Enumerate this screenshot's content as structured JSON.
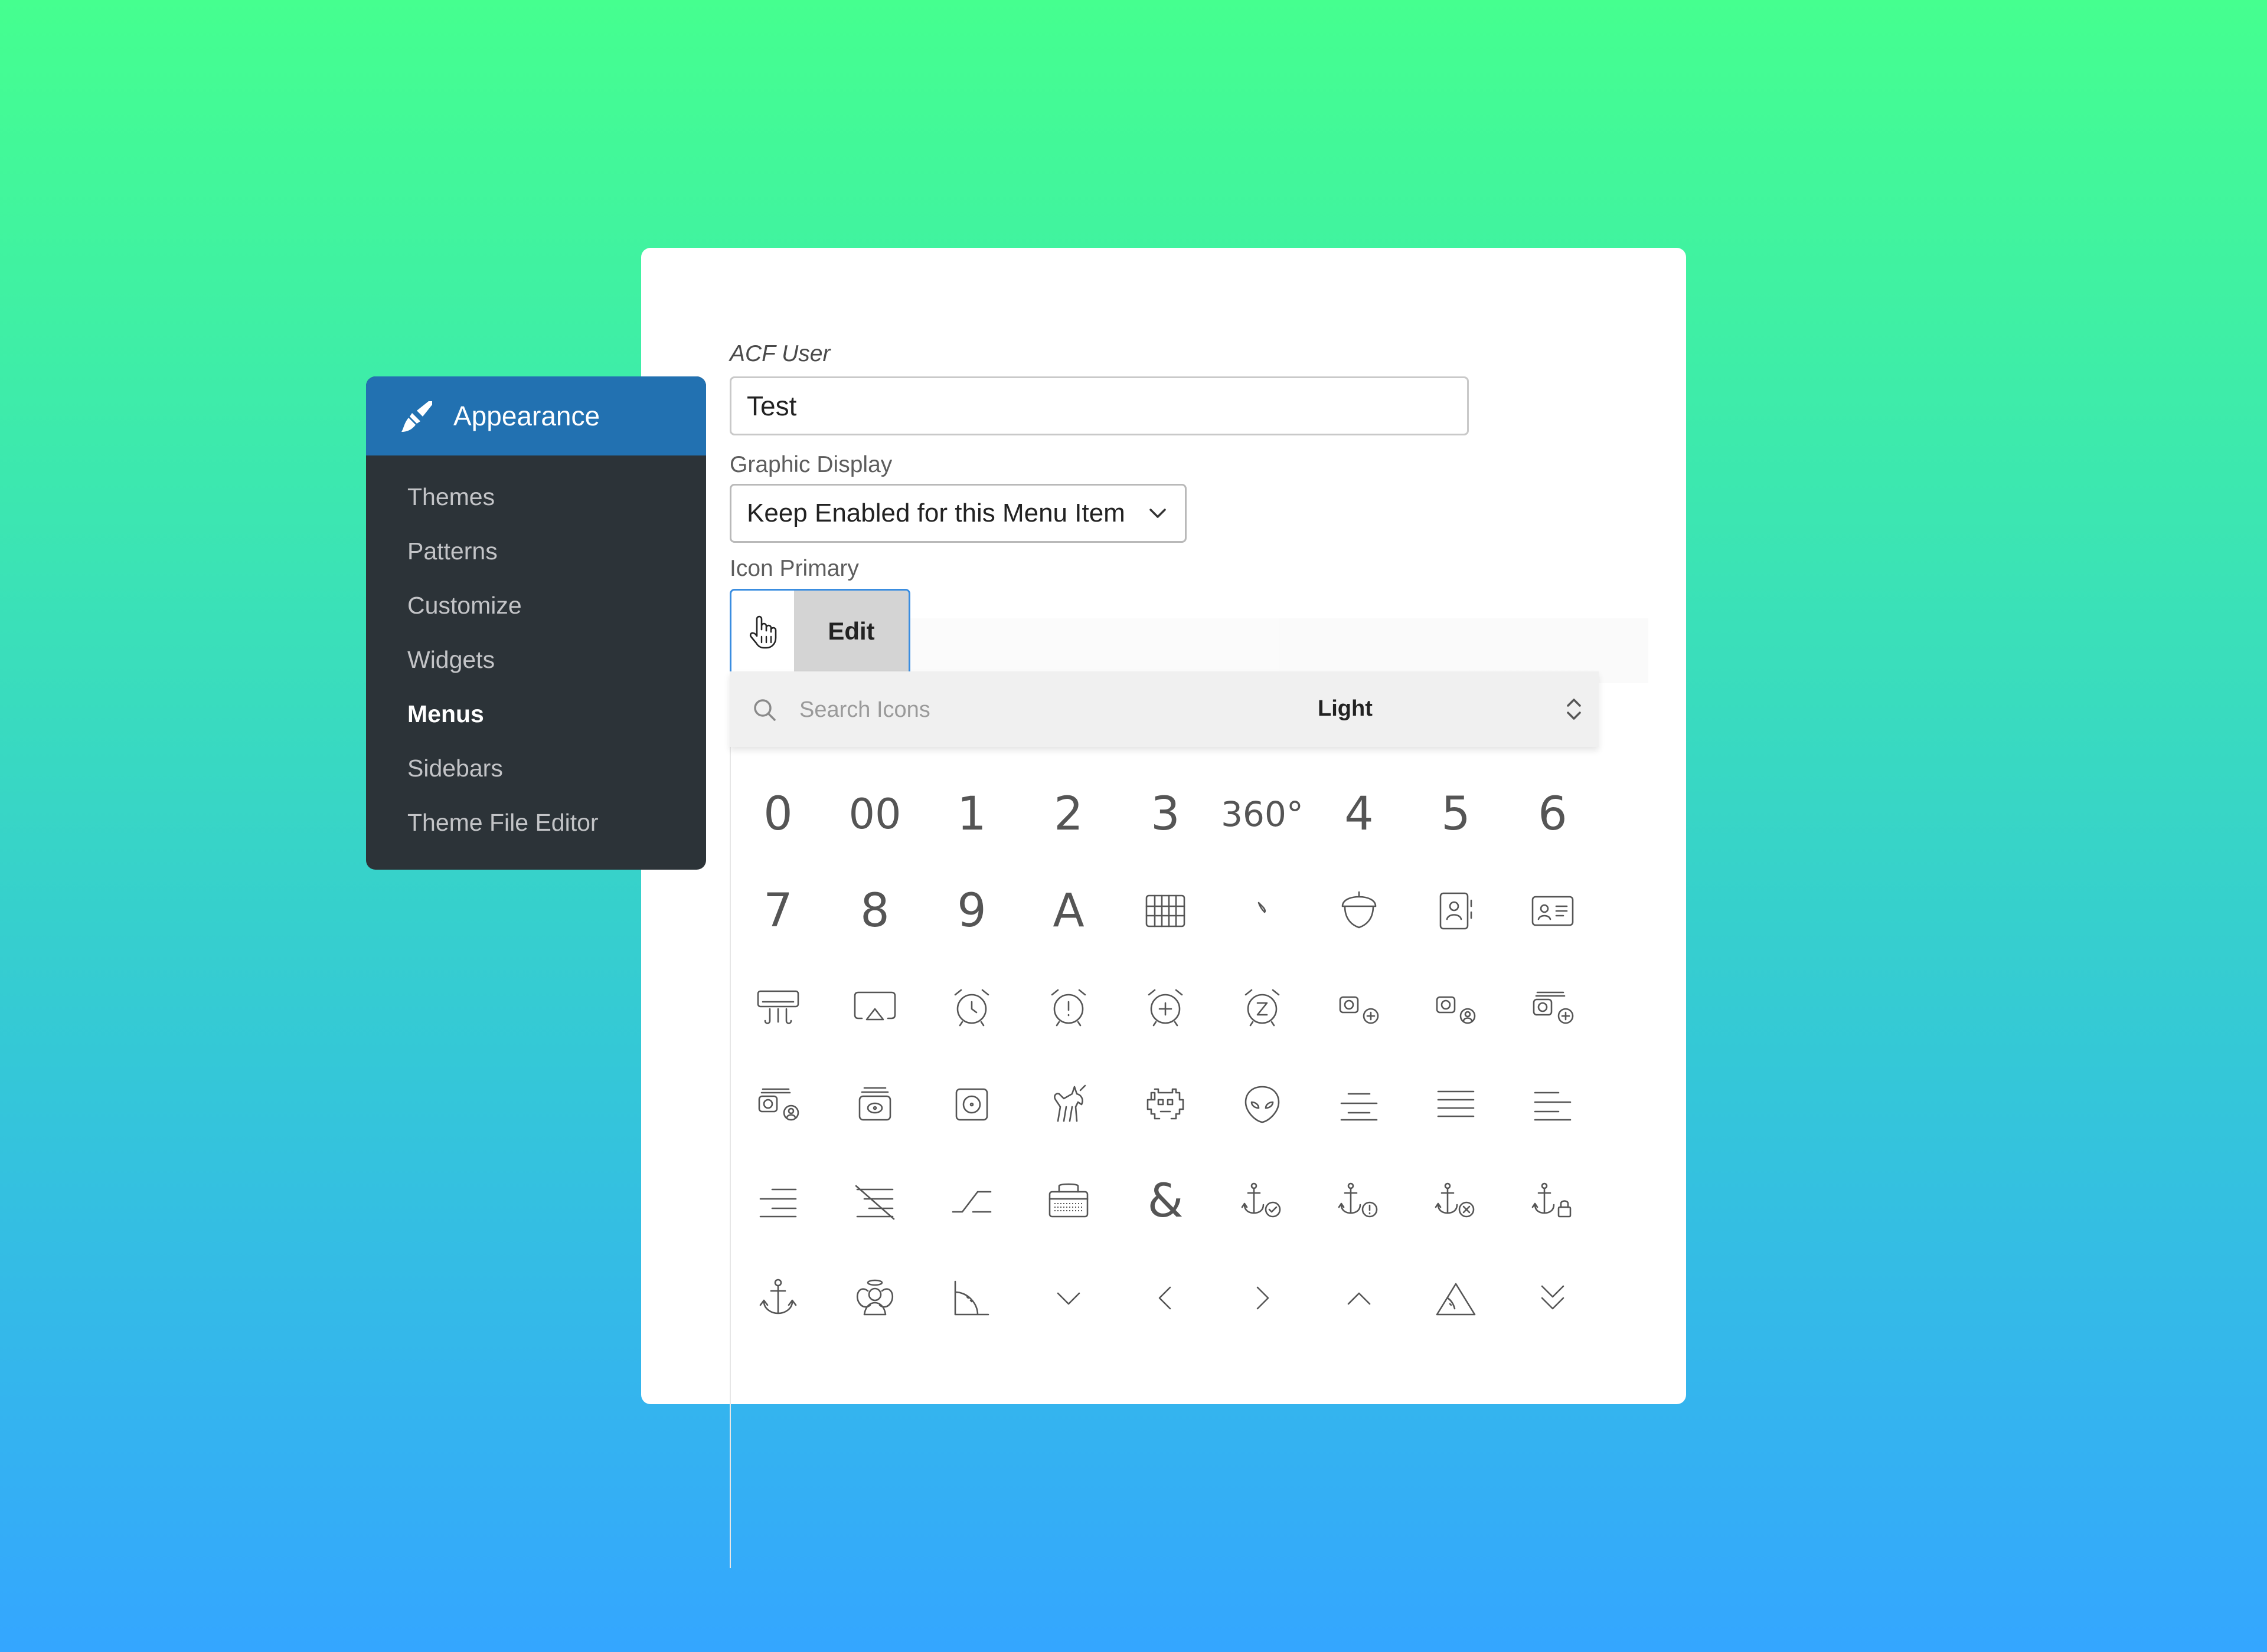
{
  "sidebar": {
    "title": "Appearance",
    "items": [
      {
        "label": "Themes"
      },
      {
        "label": "Patterns"
      },
      {
        "label": "Customize"
      },
      {
        "label": "Widgets"
      },
      {
        "label": "Menus",
        "active": true
      },
      {
        "label": "Sidebars"
      },
      {
        "label": "Theme File Editor"
      }
    ],
    "header_color": "#2271b1",
    "bg_color": "#2c3338"
  },
  "form": {
    "acf_user_label": "ACF User",
    "acf_user_value": "Test",
    "graphic_display_label": "Graphic Display",
    "graphic_display_value": "Keep Enabled for this Menu Item",
    "icon_primary_label": "Icon Primary",
    "edit_label": "Edit"
  },
  "icon_panel": {
    "search_placeholder": "Search Icons",
    "style_value": "Light",
    "icons": [
      {
        "name": "0",
        "glyph": "0"
      },
      {
        "name": "00",
        "glyph": "00"
      },
      {
        "name": "1",
        "glyph": "1"
      },
      {
        "name": "2",
        "glyph": "2"
      },
      {
        "name": "3",
        "glyph": "3"
      },
      {
        "name": "360-degrees",
        "glyph": "360°"
      },
      {
        "name": "4",
        "glyph": "4"
      },
      {
        "name": "5",
        "glyph": "5"
      },
      {
        "name": "6",
        "glyph": "6"
      },
      {
        "name": "7",
        "glyph": "7"
      },
      {
        "name": "8",
        "glyph": "8"
      },
      {
        "name": "9",
        "glyph": "9"
      },
      {
        "name": "a",
        "glyph": "A"
      },
      {
        "name": "abacus"
      },
      {
        "name": "accent-grave"
      },
      {
        "name": "acorn"
      },
      {
        "name": "address-book"
      },
      {
        "name": "address-card"
      },
      {
        "name": "air-conditioner"
      },
      {
        "name": "airplay"
      },
      {
        "name": "alarm-clock"
      },
      {
        "name": "alarm-exclamation"
      },
      {
        "name": "alarm-plus"
      },
      {
        "name": "alarm-snooze"
      },
      {
        "name": "album-circle-plus"
      },
      {
        "name": "album-circle-user"
      },
      {
        "name": "album-collection-circle-plus"
      },
      {
        "name": "album-collection-circle-user"
      },
      {
        "name": "album-collection"
      },
      {
        "name": "album"
      },
      {
        "name": "alicorn"
      },
      {
        "name": "alien-8bit"
      },
      {
        "name": "alien"
      },
      {
        "name": "align-center"
      },
      {
        "name": "align-justify"
      },
      {
        "name": "align-left"
      },
      {
        "name": "align-right"
      },
      {
        "name": "align-slash"
      },
      {
        "name": "alt"
      },
      {
        "name": "amp-guitar"
      },
      {
        "name": "ampersand",
        "glyph": "&"
      },
      {
        "name": "anchor-circle-check"
      },
      {
        "name": "anchor-circle-exclamation"
      },
      {
        "name": "anchor-circle-xmark"
      },
      {
        "name": "anchor-lock"
      },
      {
        "name": "anchor"
      },
      {
        "name": "angel"
      },
      {
        "name": "angle-90"
      },
      {
        "name": "angle-down"
      },
      {
        "name": "angle-left"
      },
      {
        "name": "angle-right"
      },
      {
        "name": "angle-up"
      },
      {
        "name": "angle"
      },
      {
        "name": "angles-down"
      }
    ]
  }
}
